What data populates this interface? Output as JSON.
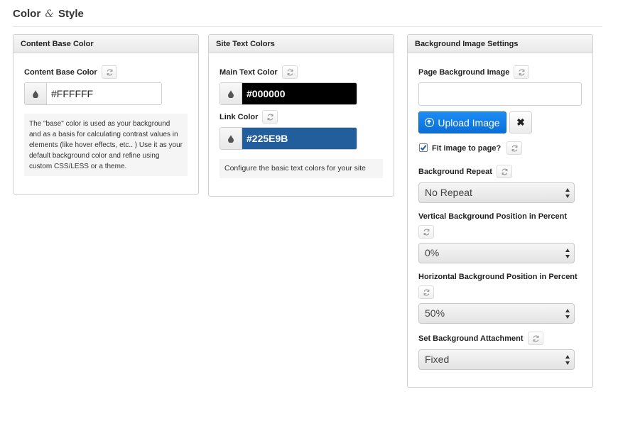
{
  "header": {
    "title_part1": "Color",
    "title_amp": "&",
    "title_part2": "Style"
  },
  "content_base_panel": {
    "title": "Content Base Color",
    "field_label": "Content Base Color",
    "value": "#FFFFFF",
    "help": "The \"base\" color is used as your background and as a basis for calculating contrast values in elements (like hover effects, etc.. ) Use it as your default background color and refine using custom CSS/LESS or a theme."
  },
  "site_text_panel": {
    "title": "Site Text Colors",
    "main_label": "Main Text Color",
    "main_value": "#000000",
    "link_label": "Link Color",
    "link_value": "#225E9B",
    "help": "Configure the basic text colors for your site"
  },
  "background_panel": {
    "title": "Background Image Settings",
    "image_label": "Page Background Image",
    "image_value": "",
    "upload_label": "Upload Image",
    "remove_label": "✖",
    "fit_label": "Fit image to page?",
    "fit_checked": true,
    "repeat_label": "Background Repeat",
    "repeat_value": "No Repeat",
    "vpos_label": "Vertical Background Position in Percent",
    "vpos_value": "0%",
    "hpos_label": "Horizontal Background Position in Percent",
    "hpos_value": "50%",
    "attach_label": "Set Background Attachment",
    "attach_value": "Fixed"
  },
  "colors": {
    "main_swatch": "#000000",
    "link_swatch": "#225E9B",
    "accent": "#0a6ed8"
  },
  "icons": {
    "reset": "refresh-icon",
    "drop": "droplet-icon",
    "upload": "upload-circle-icon",
    "remove": "close-icon",
    "select": "select-arrows-icon"
  }
}
